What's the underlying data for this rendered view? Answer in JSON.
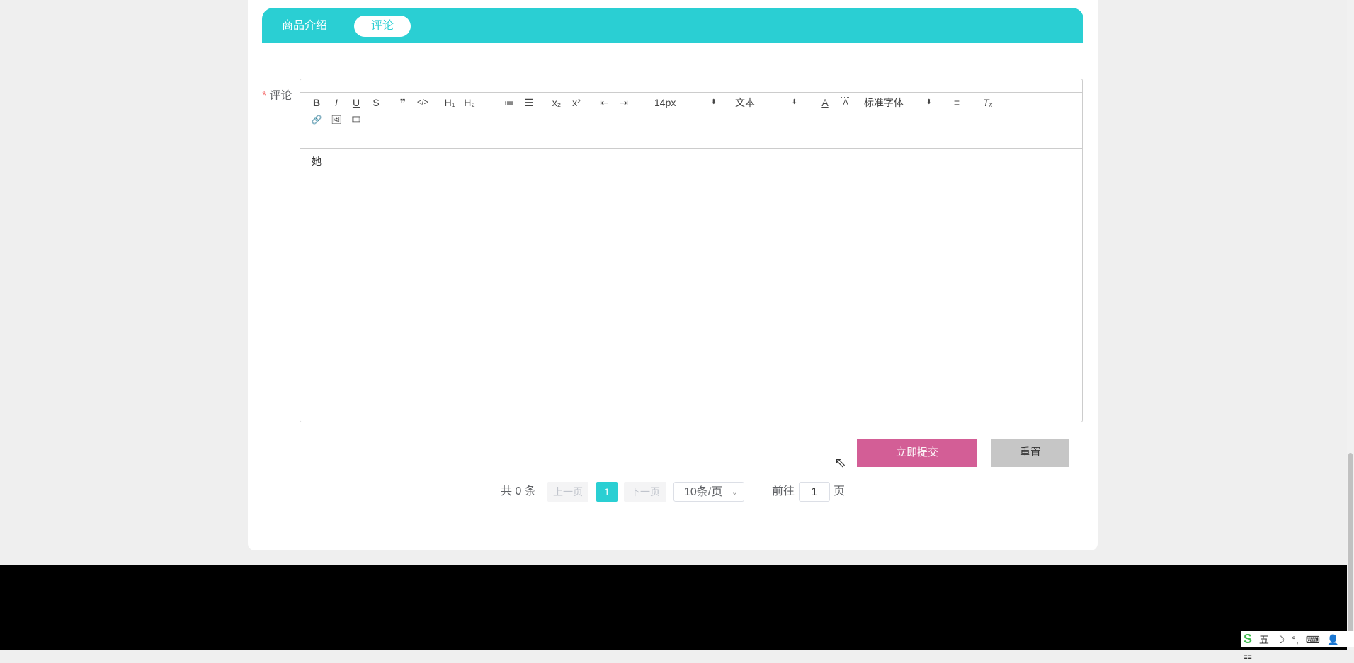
{
  "tabs": {
    "intro": "商品介绍",
    "comment": "评论"
  },
  "form": {
    "required_mark": "*",
    "label": "评论"
  },
  "toolbar": {
    "bold": "B",
    "italic": "I",
    "underline": "U",
    "strike": "S",
    "quote": "❞",
    "code": "</>",
    "h1": "H₁",
    "h2": "H₂",
    "ordered_list": "≔",
    "bullet_list": "☰",
    "subscript": "x₂",
    "superscript": "x²",
    "outdent": "⇤",
    "indent": "⇥",
    "size": "14px",
    "header": "文本",
    "font_color": "A",
    "bg_color": "A",
    "font": "标准字体",
    "align": "≡",
    "clean": "Tₓ",
    "link": "🔗",
    "image": "🖼",
    "video": "🎞",
    "select_arrow": "⬍"
  },
  "editor": {
    "content": "她"
  },
  "buttons": {
    "submit": "立即提交",
    "reset": "重置"
  },
  "pagination": {
    "total": "共 0 条",
    "prev": "上一页",
    "current": "1",
    "next": "下一页",
    "page_size": "10条/页",
    "goto": "前往",
    "goto_value": "1",
    "page_unit": "页",
    "dropdown_arrow": "⌄"
  },
  "tray": {
    "ime_logo": "S",
    "mode": "五",
    "moon": "☽",
    "punct": "°,",
    "keyboard": "⌨",
    "user": "👤",
    "grid": "⚏"
  }
}
